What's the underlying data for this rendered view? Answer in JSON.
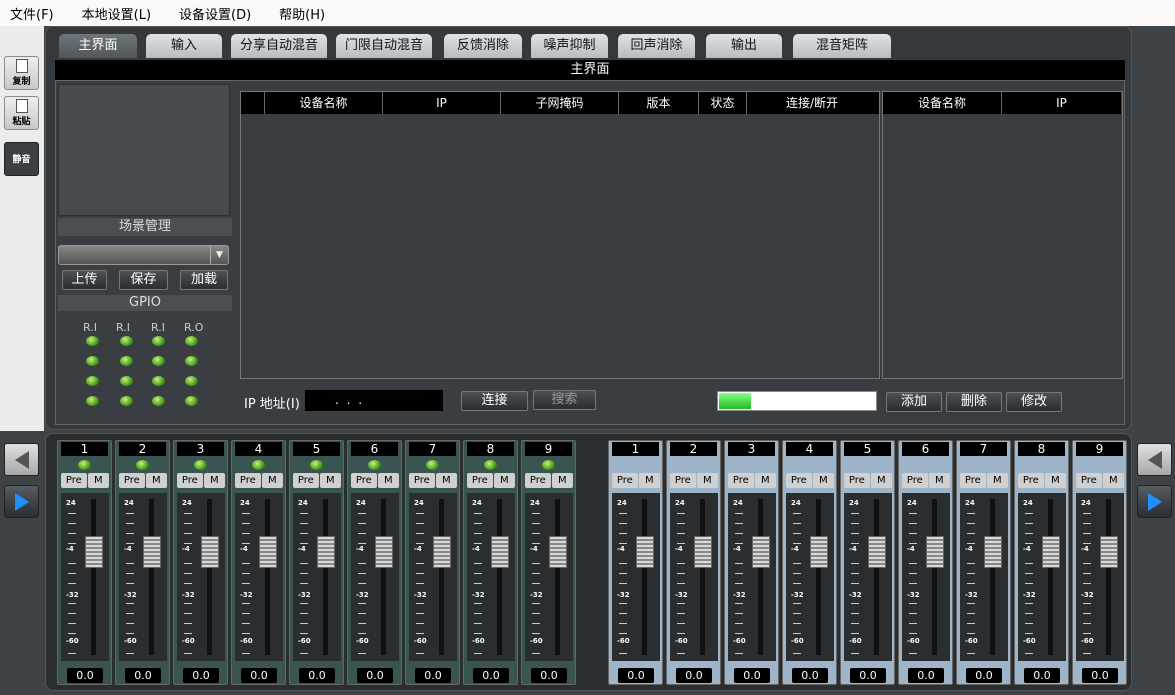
{
  "menu": [
    "文件(F)",
    "本地设置(L)",
    "设备设置(D)",
    "帮助(H)"
  ],
  "sidebar": {
    "copy": "复制",
    "paste": "粘贴",
    "mute": "静音"
  },
  "tabs": [
    "主界面",
    "输入",
    "分享自动混音",
    "门限自动混音",
    "反馈消除",
    "噪声抑制",
    "回声消除",
    "输出",
    "混音矩阵"
  ],
  "title": "主界面",
  "scene": {
    "heading": "场景管理",
    "upload": "上传",
    "save": "保存",
    "load": "加载"
  },
  "gpio": {
    "heading": "GPIO",
    "labels": [
      "R.I",
      "R.I",
      "R.I",
      "R.O"
    ]
  },
  "device_table": {
    "columns": [
      "",
      "设备名称",
      "IP",
      "子网掩码",
      "版本",
      "状态",
      "连接/断开"
    ]
  },
  "right_table": {
    "columns": [
      "设备名称",
      "IP"
    ]
  },
  "ip": {
    "label": "IP 地址(I)",
    "value": ".       .       ."
  },
  "buttons": {
    "connect": "连接",
    "search": "搜索",
    "add": "添加",
    "delete": "删除",
    "modify": "修改"
  },
  "progress": 0.2,
  "mixer": {
    "inputs": [
      "1",
      "2",
      "3",
      "4",
      "5",
      "6",
      "7",
      "8",
      "9"
    ],
    "outputs": [
      "1",
      "2",
      "3",
      "4",
      "5",
      "6",
      "7",
      "8",
      "9"
    ],
    "pre": "Pre",
    "m": "M",
    "scale": [
      "24",
      "-4",
      "-32",
      "-60"
    ],
    "value": "0.0",
    "fader_level": 0.7
  },
  "colors": {
    "led": "#4a9d1d",
    "input_strip": "#3a5551",
    "output_strip": "#9eb4c8",
    "nav_arrow": "#1e90ff"
  }
}
